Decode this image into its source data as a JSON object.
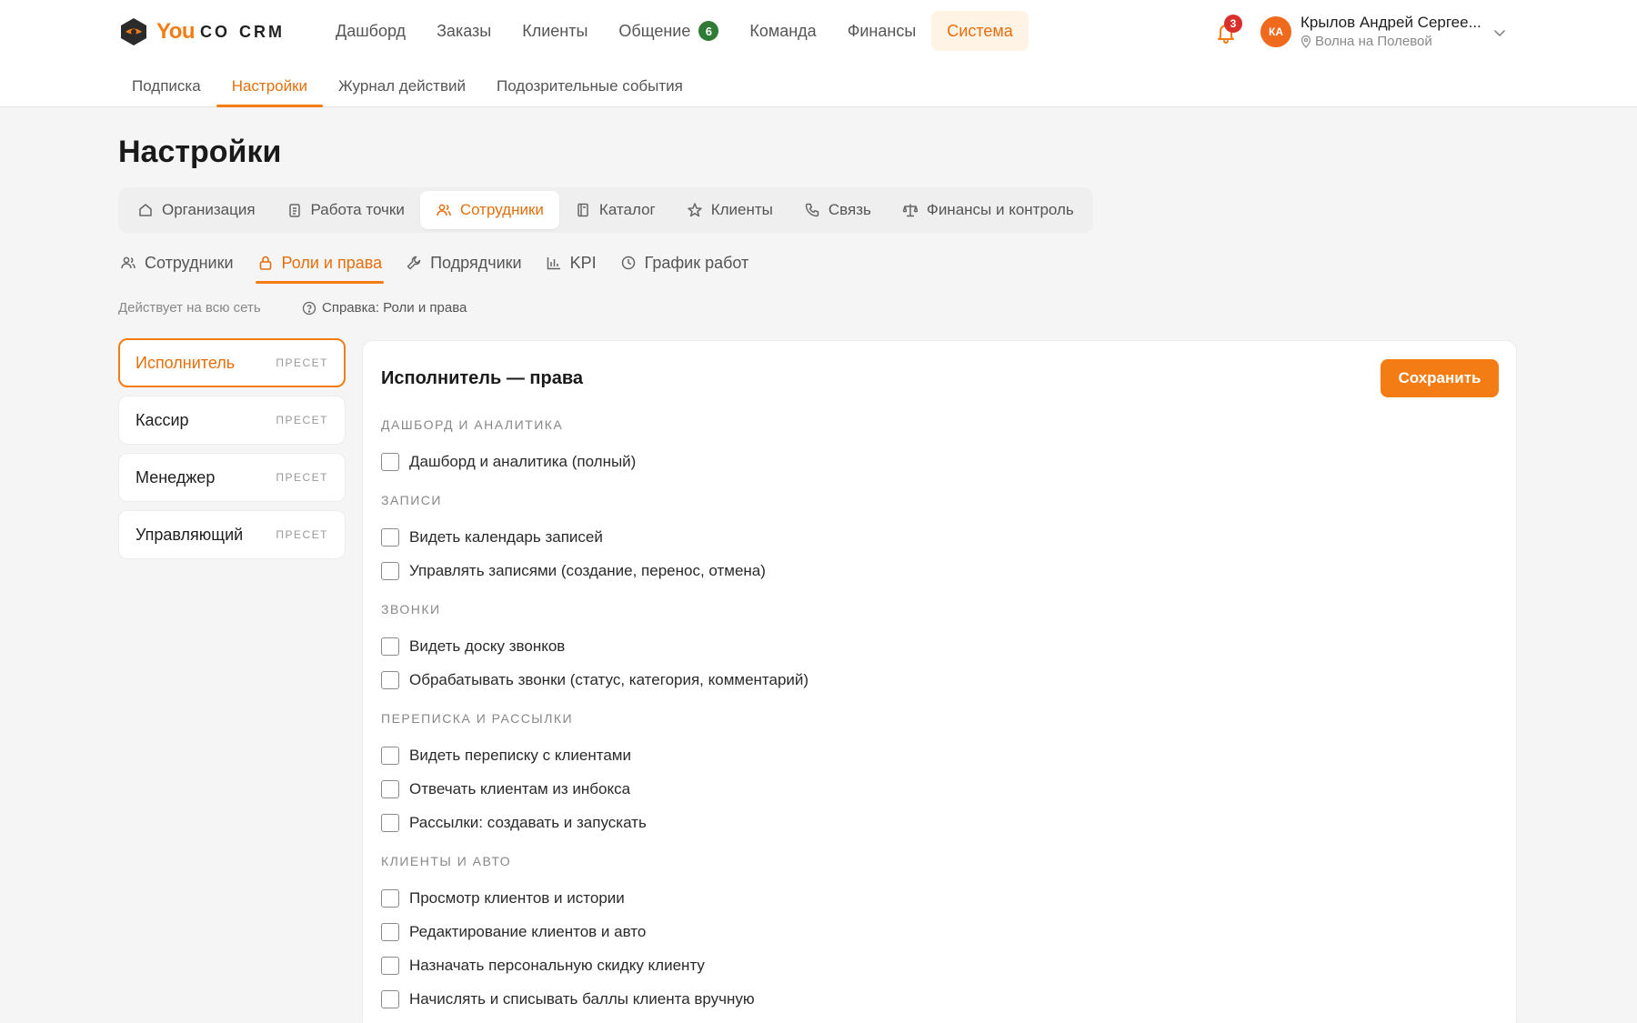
{
  "brand": {
    "you": "You",
    "co": "CO",
    "crm": "CRM"
  },
  "main_nav": [
    {
      "label": "Дашборд",
      "active": false
    },
    {
      "label": "Заказы",
      "active": false
    },
    {
      "label": "Клиенты",
      "active": false
    },
    {
      "label": "Общение",
      "active": false,
      "badge": "6"
    },
    {
      "label": "Команда",
      "active": false
    },
    {
      "label": "Финансы",
      "active": false
    },
    {
      "label": "Система",
      "active": true
    }
  ],
  "sub_nav": [
    {
      "label": "Подписка",
      "active": false
    },
    {
      "label": "Настройки",
      "active": true
    },
    {
      "label": "Журнал действий",
      "active": false
    },
    {
      "label": "Подозрительные события",
      "active": false
    }
  ],
  "notifications": {
    "count": "3",
    "icon": "bell-icon"
  },
  "user": {
    "initials": "КА",
    "name": "Крылов Андрей Сергее...",
    "location": "Волна на Полевой"
  },
  "page": {
    "title": "Настройки"
  },
  "settings_tabs": [
    {
      "label": "Организация",
      "icon": "home-icon",
      "active": false
    },
    {
      "label": "Работа точки",
      "icon": "clipboard-icon",
      "active": false
    },
    {
      "label": "Сотрудники",
      "icon": "users-icon",
      "active": true
    },
    {
      "label": "Каталог",
      "icon": "book-icon",
      "active": false
    },
    {
      "label": "Клиенты",
      "icon": "star-icon",
      "active": false
    },
    {
      "label": "Связь",
      "icon": "phone-icon",
      "active": false
    },
    {
      "label": "Финансы и контроль",
      "icon": "scales-icon",
      "active": false
    }
  ],
  "employee_tabs": [
    {
      "label": "Сотрудники",
      "icon": "users-icon",
      "active": false
    },
    {
      "label": "Роли и права",
      "icon": "lock-icon",
      "active": true
    },
    {
      "label": "Подрядчики",
      "icon": "wrench-icon",
      "active": false
    },
    {
      "label": "KPI",
      "icon": "bar-chart-icon",
      "active": false
    },
    {
      "label": "График работ",
      "icon": "clock-icon",
      "active": false
    }
  ],
  "scope_note": "Действует на всю сеть",
  "help_link": "Справка: Роли и права",
  "roles": [
    {
      "name": "Исполнитель",
      "tag": "ПРЕСЕТ",
      "active": true
    },
    {
      "name": "Кассир",
      "tag": "ПРЕСЕТ",
      "active": false
    },
    {
      "name": "Менеджер",
      "tag": "ПРЕСЕТ",
      "active": false
    },
    {
      "name": "Управляющий",
      "tag": "ПРЕСЕТ",
      "active": false
    }
  ],
  "panel": {
    "title": "Исполнитель — права",
    "save_label": "Сохранить",
    "sections": [
      {
        "title": "ДАШБОРД И АНАЛИТИКА",
        "items": [
          "Дашборд и аналитика (полный)"
        ]
      },
      {
        "title": "ЗАПИСИ",
        "items": [
          "Видеть календарь записей",
          "Управлять записями (создание, перенос, отмена)"
        ]
      },
      {
        "title": "ЗВОНКИ",
        "items": [
          "Видеть доску звонков",
          "Обрабатывать звонки (статус, категория, комментарий)"
        ]
      },
      {
        "title": "ПЕРЕПИСКА И РАССЫЛКИ",
        "items": [
          "Видеть переписку с клиентами",
          "Отвечать клиентам из инбокса",
          "Рассылки: создавать и запускать"
        ]
      },
      {
        "title": "КЛИЕНТЫ И АВТО",
        "items": [
          "Просмотр клиентов и истории",
          "Редактирование клиентов и авто",
          "Назначать персональную скидку клиенту",
          "Начислять и списывать баллы клиента вручную"
        ]
      }
    ]
  },
  "colors": {
    "accent": "#f47c14",
    "badge_green": "#2f7a34",
    "badge_red": "#d9302c",
    "avatar": "#f06a1d"
  }
}
